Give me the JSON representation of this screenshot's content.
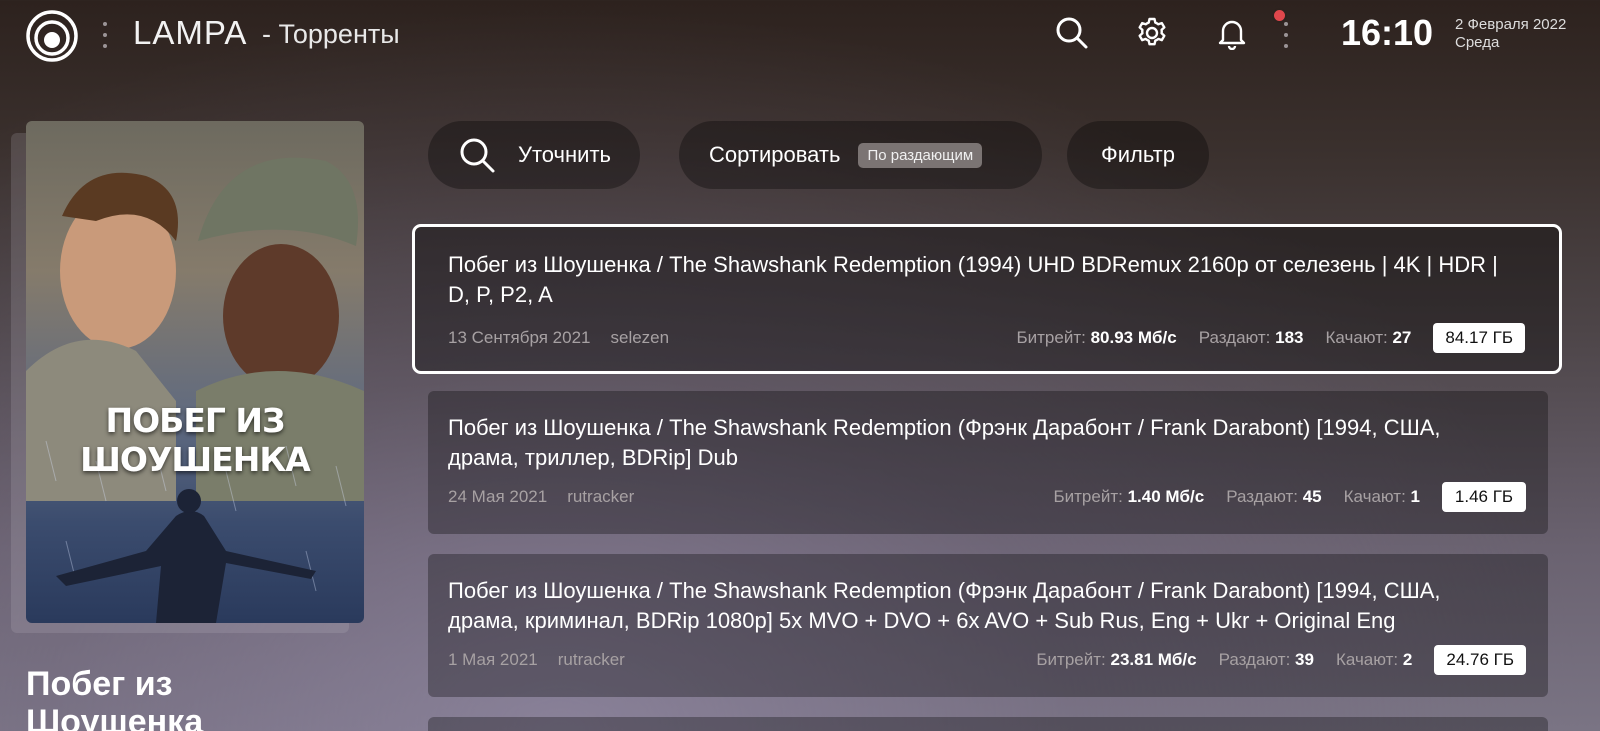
{
  "header": {
    "app_name": "LAMPA",
    "page_title": "- Торренты",
    "time": "16:10",
    "date": "2 Февраля 2022",
    "weekday": "Среда",
    "icons": [
      "lampa-logo-icon",
      "search-icon",
      "gear-icon",
      "bell-icon"
    ],
    "notification_dot_color": "#e0474c"
  },
  "movie": {
    "poster_title": "ПОБЕГ ИЗ ШОУШЕНКА",
    "title": "Побег из Шоушенка"
  },
  "toolbar": {
    "refine_label": "Уточнить",
    "sort_label": "Сортировать",
    "sort_value": "По раздающим",
    "filter_label": "Фильтр"
  },
  "labels": {
    "bitrate": "Битрейт:",
    "seeders": "Раздают:",
    "leechers": "Качают:"
  },
  "torrents": [
    {
      "title": "Побег из Шоушенка / The Shawshank Redemption (1994) UHD BDRemux 2160p от селезень | 4K | HDR | D, P, P2, A",
      "date": "13 Сентября 2021",
      "source": "selezen",
      "bitrate": "80.93 Мб/с",
      "seeders": "183",
      "leechers": "27",
      "size": "84.17 ГБ"
    },
    {
      "title": "Побег из Шоушенка / The Shawshank Redemption (Фрэнк Дарабонт / Frank Darabont) [1994, США, драма, триллер, BDRip] Dub",
      "date": "24 Мая 2021",
      "source": "rutracker",
      "bitrate": "1.40 Мб/с",
      "seeders": "45",
      "leechers": "1",
      "size": "1.46 ГБ"
    },
    {
      "title": "Побег из Шоушенка / The Shawshank Redemption (Фрэнк Дарабонт / Frank Darabont) [1994, США, драма, криминал, BDRip 1080p] 5x MVO + DVO + 6x AVO + Sub Rus, Eng + Ukr + Original Eng",
      "date": "1 Мая 2021",
      "source": "rutracker",
      "bitrate": "23.81 Мб/с",
      "seeders": "39",
      "leechers": "2",
      "size": "24.76 ГБ"
    }
  ]
}
